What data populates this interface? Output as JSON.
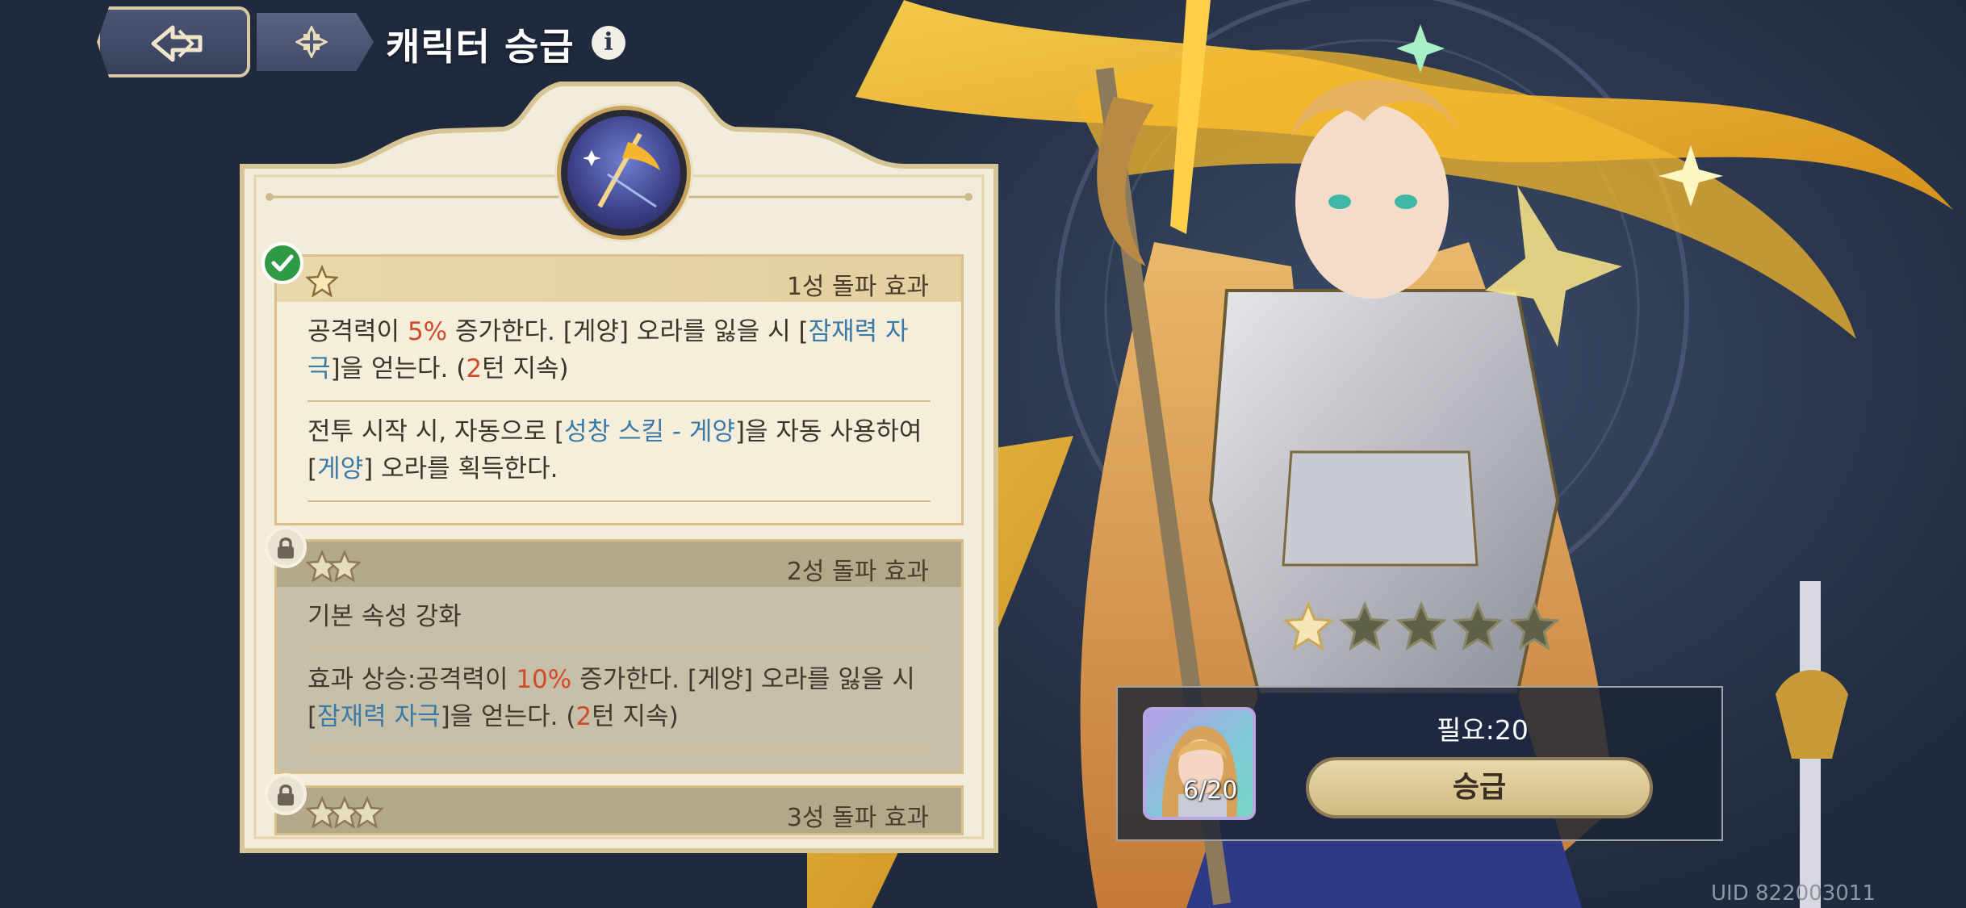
{
  "header": {
    "title": "캐릭터 승급"
  },
  "cards": [
    {
      "title": "1성 돌파 효과",
      "stars": 1,
      "status": "unlocked",
      "paragraphs": [
        [
          {
            "t": "공격력이 "
          },
          {
            "t": "5%",
            "c": "red"
          },
          {
            "t": " 증가한다. [게양] 오라를 잃을 시 ["
          },
          {
            "t": "잠재력 자극",
            "c": "blue"
          },
          {
            "t": "]을 얻는다. ("
          },
          {
            "t": "2",
            "c": "red"
          },
          {
            "t": "턴 지속)"
          }
        ],
        [
          {
            "t": "전투 시작 시, 자동으로 ["
          },
          {
            "t": "성창 스킬 - 게양",
            "c": "blue"
          },
          {
            "t": "]을 자동 사용하여 ["
          },
          {
            "t": "게양",
            "c": "blue"
          },
          {
            "t": "] 오라를 획득한다."
          }
        ]
      ]
    },
    {
      "title": "2성 돌파 효과",
      "stars": 2,
      "status": "locked",
      "paragraphs": [
        [
          {
            "t": "기본 속성 강화"
          }
        ],
        [
          {
            "t": "효과 상승:공격력이 "
          },
          {
            "t": "10%",
            "c": "red"
          },
          {
            "t": " 증가한다. [게양] 오라를 잃을 시 ["
          },
          {
            "t": "잠재력 자극",
            "c": "blue"
          },
          {
            "t": "]을 얻는다. ("
          },
          {
            "t": "2",
            "c": "red"
          },
          {
            "t": "턴 지속)"
          }
        ]
      ]
    },
    {
      "title": "3성 돌파 효과",
      "stars": 3,
      "status": "locked",
      "paragraphs": []
    }
  ],
  "rank": {
    "current": 1,
    "max": 5
  },
  "upgrade": {
    "item_count": "6/20",
    "need_label": "필요:20",
    "button_label": "승급"
  },
  "uid": "UID 822003011",
  "colors": {
    "accent_red": "#d24a2b",
    "accent_blue": "#3a7aa8",
    "check_green": "#2f9a45",
    "panel_cream": "#f4eedb"
  },
  "icons": {
    "back": "back-arrow-icon",
    "home": "menu-grid-icon",
    "info": "info-icon",
    "unlocked": "check-icon",
    "locked": "lock-icon",
    "star": "star-icon"
  }
}
